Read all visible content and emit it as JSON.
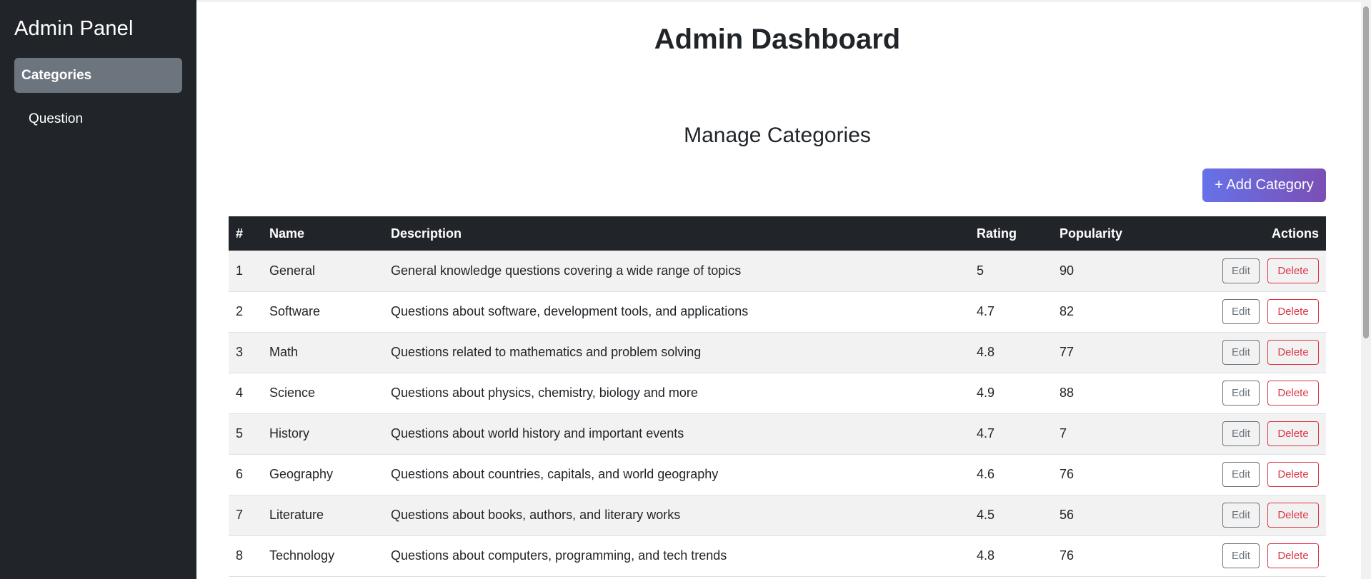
{
  "sidebar": {
    "title": "Admin Panel",
    "items": [
      {
        "label": "Categories",
        "active": true
      },
      {
        "label": "Question",
        "active": false
      }
    ]
  },
  "main": {
    "page_title": "Admin Dashboard",
    "section_title": "Manage Categories",
    "add_button_label": "+ Add Category"
  },
  "table": {
    "headers": {
      "num": "#",
      "name": "Name",
      "description": "Description",
      "rating": "Rating",
      "popularity": "Popularity",
      "actions": "Actions"
    },
    "rows": [
      {
        "num": "1",
        "name": "General",
        "description": "General knowledge questions covering a wide range of topics",
        "rating": "5",
        "popularity": "90"
      },
      {
        "num": "2",
        "name": "Software",
        "description": "Questions about software, development tools, and applications",
        "rating": "4.7",
        "popularity": "82"
      },
      {
        "num": "3",
        "name": "Math",
        "description": "Questions related to mathematics and problem solving",
        "rating": "4.8",
        "popularity": "77"
      },
      {
        "num": "4",
        "name": "Science",
        "description": "Questions about physics, chemistry, biology and more",
        "rating": "4.9",
        "popularity": "88"
      },
      {
        "num": "5",
        "name": "History",
        "description": "Questions about world history and important events",
        "rating": "4.7",
        "popularity": "7"
      },
      {
        "num": "6",
        "name": "Geography",
        "description": "Questions about countries, capitals, and world geography",
        "rating": "4.6",
        "popularity": "76"
      },
      {
        "num": "7",
        "name": "Literature",
        "description": "Questions about books, authors, and literary works",
        "rating": "4.5",
        "popularity": "56"
      },
      {
        "num": "8",
        "name": "Technology",
        "description": "Questions about computers, programming, and tech trends",
        "rating": "4.8",
        "popularity": "76"
      }
    ],
    "edit_label": "Edit",
    "delete_label": "Delete"
  },
  "colors": {
    "sidebar_bg": "#212529",
    "active_item_bg": "#6c757d",
    "accent_gradient_start": "#6672e8",
    "accent_gradient_end": "#7b4fb5",
    "delete": "#dc3545"
  }
}
